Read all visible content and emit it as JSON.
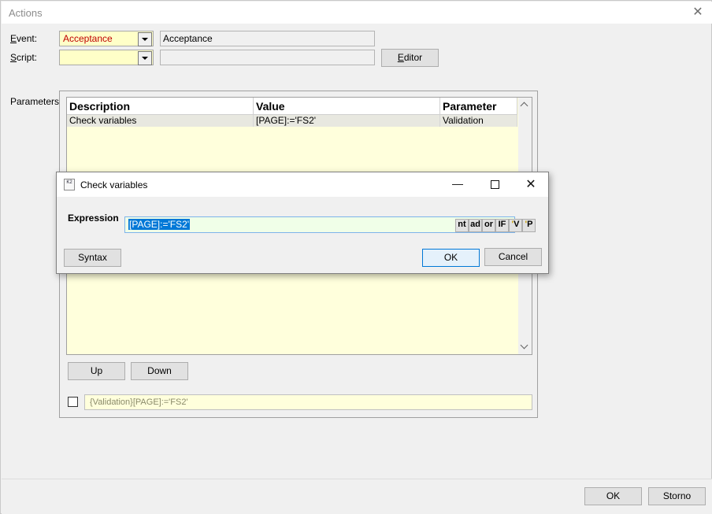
{
  "window": {
    "title": "Actions"
  },
  "event": {
    "label": "Event:",
    "value": "Acceptance",
    "name": "Acceptance"
  },
  "script": {
    "label": "Script:",
    "value": "",
    "name": ""
  },
  "editor_button": "Editor",
  "parameters": {
    "label": "Parameters:",
    "columns": [
      "Description",
      "Value",
      "Parameter"
    ],
    "rows": [
      {
        "description": "Check variables",
        "value": "[PAGE]:='FS2'",
        "parameter": "Validation"
      }
    ]
  },
  "up_button": "Up",
  "down_button": "Down",
  "summary_text": "{Validation}[PAGE]:='FS2'",
  "dialog": {
    "title": "Check variables",
    "icon_text": "K2",
    "expression_label": "Expression",
    "expression_value": "[PAGE]:='FS2'",
    "toolbar": [
      "nt",
      "ad",
      "or",
      "IF",
      "V",
      "P"
    ],
    "syntax_button": "Syntax",
    "ok_button": "OK",
    "cancel_button": "Cancel"
  },
  "ok_button": "OK",
  "storno_button": "Storno",
  "colors": {
    "event_value": "#c00000",
    "selection": "#0078d7"
  }
}
